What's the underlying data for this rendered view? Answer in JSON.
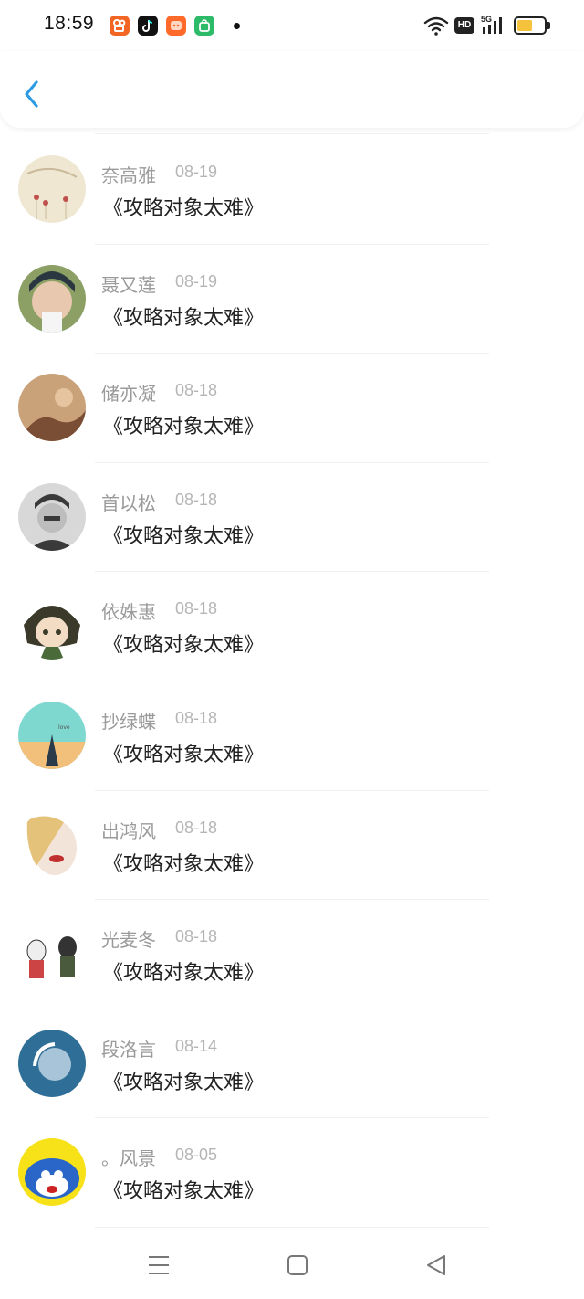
{
  "status_bar": {
    "time": "18:59",
    "app_icons": [
      "kuaishou-icon",
      "douyin-icon",
      "taobao-icon",
      "app-store-icon"
    ],
    "network_badge": "HD",
    "network_type": "5G",
    "battery_level": 0.45
  },
  "header": {
    "back_icon": "chevron-left-icon",
    "accent_color": "#2d9be4"
  },
  "items": [
    {
      "name": "奈高雅",
      "date": "08-19",
      "title": "《攻略对象太难》",
      "avatar_colors": [
        "#efe7d2",
        "#c9b99a"
      ]
    },
    {
      "name": "聂又莲",
      "date": "08-19",
      "title": "《攻略对象太难》",
      "avatar_colors": [
        "#2a3640",
        "#8ca066"
      ]
    },
    {
      "name": "储亦凝",
      "date": "08-18",
      "title": "《攻略对象太难》",
      "avatar_colors": [
        "#caa27a",
        "#7a4d35"
      ]
    },
    {
      "name": "首以松",
      "date": "08-18",
      "title": "《攻略对象太难》",
      "avatar_colors": [
        "#d8d8d8",
        "#3a3a3a"
      ]
    },
    {
      "name": "依姝惠",
      "date": "08-18",
      "title": "《攻略对象太难》",
      "avatar_colors": [
        "#3b3a2a",
        "#f2dcc4"
      ]
    },
    {
      "name": "抄绿蝶",
      "date": "08-18",
      "title": "《攻略对象太难》",
      "avatar_colors": [
        "#7fd8d0",
        "#f2c07a"
      ]
    },
    {
      "name": "出鸿风",
      "date": "08-18",
      "title": "《攻略对象太难》",
      "avatar_colors": [
        "#f3e4da",
        "#c0302e"
      ]
    },
    {
      "name": "光麦冬",
      "date": "08-18",
      "title": "《攻略对象太难》",
      "avatar_colors": [
        "#ffffff",
        "#4a5a3c"
      ]
    },
    {
      "name": "段洛言",
      "date": "08-14",
      "title": "《攻略对象太难》",
      "avatar_colors": [
        "#2f6e96",
        "#a8c4d8"
      ]
    },
    {
      "name": "。风景",
      "date": "08-05",
      "title": "《攻略对象太难》",
      "avatar_colors": [
        "#f7e21a",
        "#2a66c8"
      ]
    }
  ],
  "nav_bar": {
    "menu_icon": "menu-icon",
    "home_icon": "home-square-icon",
    "back_icon": "back-triangle-icon"
  }
}
